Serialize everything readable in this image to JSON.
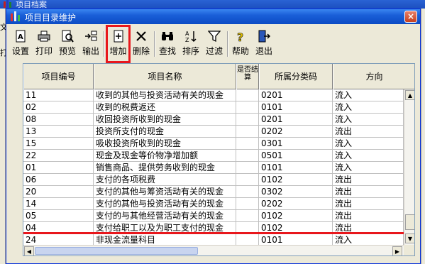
{
  "parent_window": {
    "title": "项目档案",
    "left_glyphs": [
      "文",
      "打"
    ]
  },
  "dialog": {
    "title": "项目目录维护",
    "close_label": "×"
  },
  "toolbar": [
    {
      "key": "setup",
      "label": "设置",
      "icon": "settings-icon"
    },
    {
      "key": "print",
      "label": "打印",
      "icon": "printer-icon"
    },
    {
      "key": "preview",
      "label": "预览",
      "icon": "preview-icon"
    },
    {
      "key": "export",
      "label": "输出",
      "icon": "export-icon"
    },
    {
      "key": "add",
      "label": "增加",
      "icon": "add-icon",
      "highlighted": true
    },
    {
      "key": "delete",
      "label": "删除",
      "icon": "delete-icon"
    },
    {
      "key": "find",
      "label": "查找",
      "icon": "binoculars-icon"
    },
    {
      "key": "sort",
      "label": "排序",
      "icon": "sort-icon"
    },
    {
      "key": "filter",
      "label": "过滤",
      "icon": "filter-icon"
    },
    {
      "key": "help",
      "label": "帮助",
      "icon": "help-icon"
    },
    {
      "key": "exit",
      "label": "退出",
      "icon": "exit-icon"
    }
  ],
  "grid": {
    "columns": [
      "项目编号",
      "项目名称",
      "是否结算",
      "所属分类码",
      "方向"
    ],
    "rows": [
      [
        "11",
        "收到的其他与投资活动有关的现金",
        "",
        "0201",
        "流入"
      ],
      [
        "02",
        "收到的税费返还",
        "",
        "0101",
        "流入"
      ],
      [
        "08",
        "收回投资所收到的现金",
        "",
        "0201",
        "流入"
      ],
      [
        "13",
        "投资所支付的现金",
        "",
        "0202",
        "流出"
      ],
      [
        "15",
        "吸收投资所收到的现金",
        "",
        "0301",
        "流入"
      ],
      [
        "22",
        "现金及现金等价物净增加额",
        "",
        "0501",
        "流入"
      ],
      [
        "01",
        "销售商品、提供劳务收到的现金",
        "",
        "0101",
        "流入"
      ],
      [
        "06",
        "支付的各项税费",
        "",
        "0102",
        "流出"
      ],
      [
        "20",
        "支付的其他与筹资活动有关的现金",
        "",
        "0302",
        "流出"
      ],
      [
        "14",
        "支付的其他与投资活动有关的现金",
        "",
        "0202",
        "流出"
      ],
      [
        "05",
        "支付的与其他经营活动有关的现金",
        "",
        "0102",
        "流出"
      ],
      [
        "04",
        "支付给职工以及为职工支付的现金",
        "",
        "0102",
        "流出"
      ],
      [
        "24",
        "非现金流量科目",
        "",
        "0101",
        "流入"
      ]
    ],
    "selected_row_index": 12
  },
  "colors": {
    "highlight": "#e8171c",
    "titlebar": "#1a5fd8"
  }
}
